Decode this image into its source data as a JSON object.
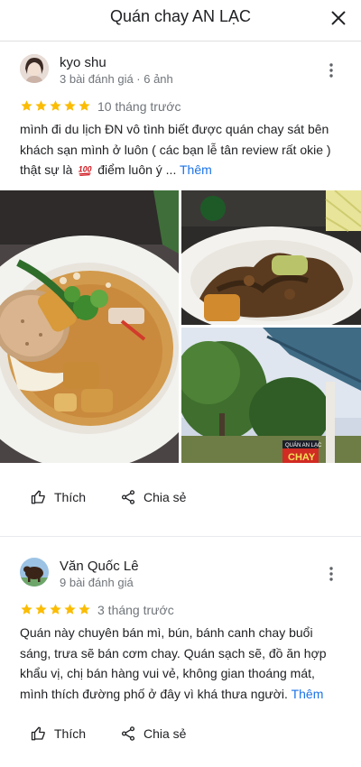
{
  "header": {
    "title": "Quán chay AN LẠC",
    "close_icon": "close-icon"
  },
  "reviews": [
    {
      "author": "kyo shu",
      "meta": "3 bài đánh giá · 6 ảnh",
      "rating": 5,
      "time": "10 tháng trước",
      "text_lines": [
        "mình đi du lịch ĐN vô tình biết được quán chay sát bên",
        "khách sạn mình ở luôn ( các bạn lễ tân review rất okie )",
        "thật sự là",
        "điểm luôn ý ..."
      ],
      "emoji": "100-points",
      "more": "Thêm",
      "like": "Thích",
      "share": "Chia sẻ"
    },
    {
      "author": "Văn Quốc Lê",
      "meta": "9 bài đánh giá",
      "rating": 5,
      "time": "3 tháng trước",
      "text_lines": [
        "Quán này chuyên bán mì, bún, bánh canh chay buổi",
        "sáng, trưa sẽ bán cơm chay. Quán sạch sẽ, đồ ăn hợp",
        "khẩu vị, chị bán hàng vui vẻ, không gian thoáng mát,",
        "mình thích đường phố ở đây vì khá thưa người."
      ],
      "more": "Thêm",
      "like": "Thích",
      "share": "Chia sẻ"
    }
  ],
  "photo_sign_text": "QUÁN AN LẠC",
  "photo_sign_text2": "CHAY",
  "colors": {
    "star": "#fbbc04",
    "link": "#1a73e8",
    "muted": "#70757a"
  }
}
